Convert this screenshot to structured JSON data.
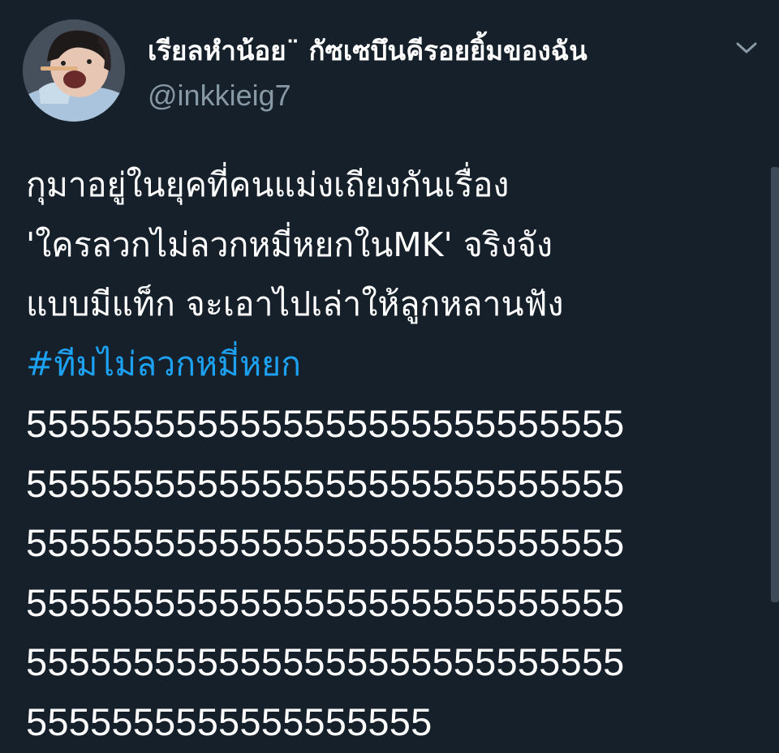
{
  "user": {
    "display_name": "เรียลหำน้อย¨ กัซเซบึนคีรอยยิ้มของฉัน",
    "handle": "@inkkieig7",
    "avatar_icon": "avatar-photo"
  },
  "tweet": {
    "lines": [
      "กุมาอยู่ในยุคที่คนแม่งเถียงกันเรื่อง",
      "'ใครลวกไม่ลวกหมี่หยกในMK' จริงจัง",
      "แบบมีแท็ก จะเอาไปเล่าให้ลูกหลานฟัง"
    ],
    "hashtag": "#ทีมไม่ลวกหมี่หยก",
    "laugh_lines": [
      "5555555555555555555555555555",
      "5555555555555555555555555555",
      "5555555555555555555555555555",
      "5555555555555555555555555555",
      "5555555555555555555555555555",
      "5555555555555555555"
    ]
  },
  "colors": {
    "background": "#15202b",
    "text": "#ffffff",
    "secondary_text": "#8899a6",
    "link": "#1da1f2"
  },
  "icons": {
    "menu": "chevron-down-icon"
  }
}
